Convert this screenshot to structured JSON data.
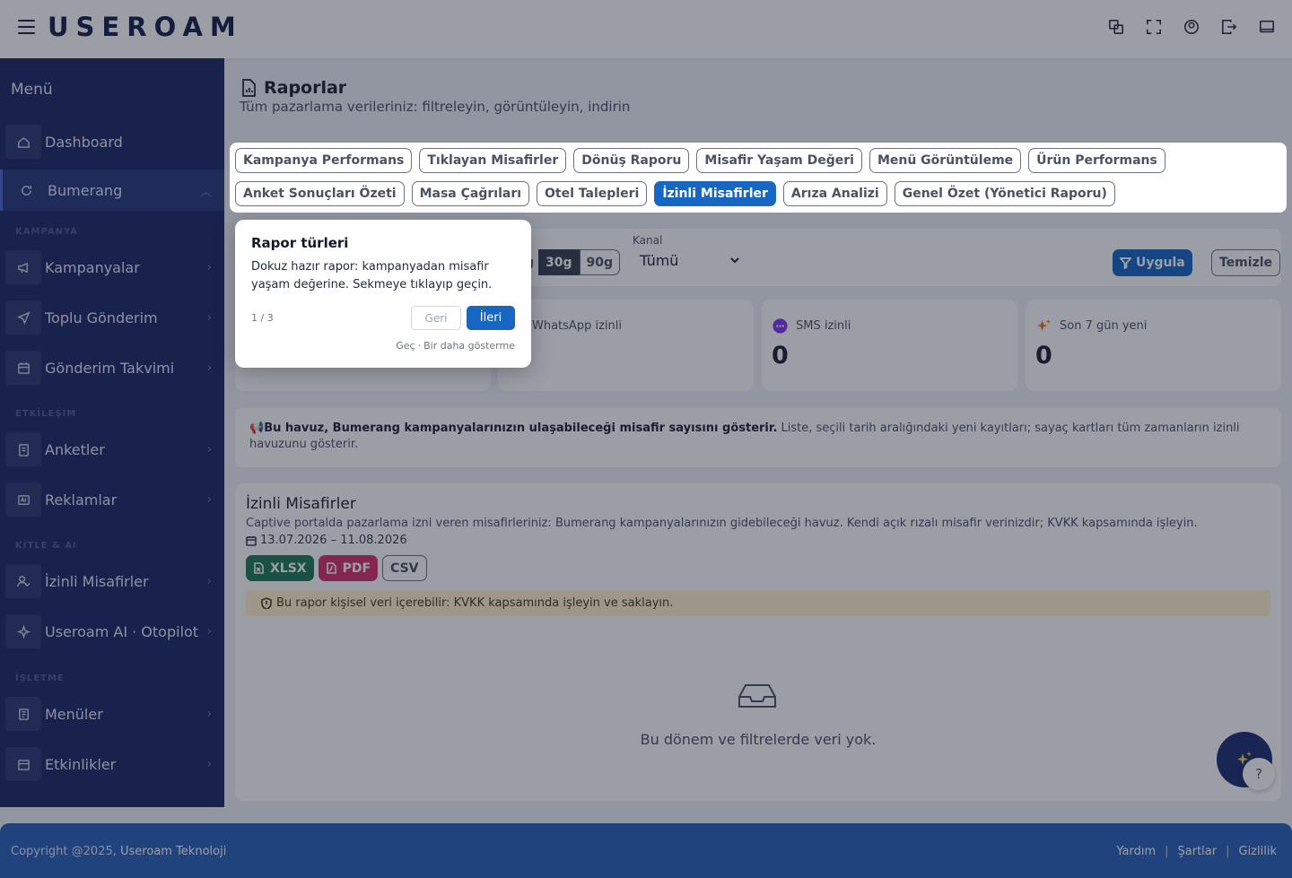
{
  "header": {
    "logo": "USEROAM",
    "icons": [
      "translate-icon",
      "fullscreen-icon",
      "user-icon",
      "logout-icon",
      "monitor-icon"
    ]
  },
  "sidebar": {
    "title": "Menü",
    "items": [
      {
        "label": "Dashboard",
        "icon": "home-icon"
      },
      {
        "label": "Bumerang",
        "icon": "refresh-icon"
      },
      {
        "label": "Kampanyalar",
        "icon": "megaphone-icon"
      },
      {
        "label": "Toplu Gönderim",
        "icon": "send-icon"
      },
      {
        "label": "Gönderim Takvimi",
        "icon": "calendar-icon"
      },
      {
        "label": "Anketler",
        "icon": "clipboard-icon"
      },
      {
        "label": "Reklamlar",
        "icon": "ad-icon"
      },
      {
        "label": "İzinli Misafirler",
        "icon": "user-check-icon"
      },
      {
        "label": "Useroam AI · Otopilot",
        "icon": "sparkle-icon"
      },
      {
        "label": "Menüler",
        "icon": "menu-book-icon"
      },
      {
        "label": "Etkinlikler",
        "icon": "event-icon"
      }
    ],
    "sections": [
      "KAMPANYA",
      "ETKİLEŞİM",
      "KİTLE & AI",
      "İŞLETME"
    ]
  },
  "page": {
    "title": "Raporlar",
    "subtitle": "Tüm pazarlama verileriniz: filtreleyin, görüntüleyin, indirin"
  },
  "tabs": [
    [
      "Kampanya Performans",
      "Tıklayan Misafirler",
      "Dönüş Raporu",
      "Misafir Yaşam Değeri",
      "Menü Görüntüleme",
      "Ürün Performans"
    ],
    [
      "Anket Sonuçları Özeti",
      "Masa Çağrıları",
      "Otel Talepleri",
      "İzinli Misafirler",
      "Arıza Analizi",
      "Genel Özet (Yönetici Raporu)"
    ]
  ],
  "active_tab": "İzinli Misafirler",
  "filters": {
    "ranges": [
      "g",
      "30g",
      "90g"
    ],
    "active_range": "30g",
    "kanal_label": "Kanal",
    "kanal_value": "Tümü",
    "apply": "Uygula",
    "clear": "Temizle"
  },
  "stats": [
    {
      "label": "WhatsApp izinli",
      "value": "",
      "icon": "whatsapp-icon"
    },
    {
      "label": "SMS izinli",
      "value": "0",
      "icon": "sms-icon"
    },
    {
      "label": "Son 7 gün yeni",
      "value": "0",
      "icon": "sparkle-icon"
    }
  ],
  "info": {
    "bold": "Bu havuz, Bumerang kampanyalarınızın ulaşabileceği misafir sayısını gösterir.",
    "text": " Liste, seçili tarih aralığındaki yeni kayıtları; sayaç kartları tüm zamanların izinli havuzunu gösterir."
  },
  "report": {
    "title": "İzinli Misafirler",
    "description": "Captive portalda pazarlama izni veren misafirleriniz: Bumerang kampanyalarınızın gidebileceği havuz. Kendi açık rızalı misafir verinizdir; KVKK kapsamında işleyin.",
    "date_range": "13.07.2026 – 11.08.2026",
    "exports": [
      "XLSX",
      "PDF",
      "CSV"
    ],
    "kvkk_note": "Bu rapor kişisel veri içerebilir: KVKK kapsamında işleyin ve saklayın.",
    "empty": "Bu dönem ve filtrelerde veri yok."
  },
  "tour": {
    "title": "Rapor türleri",
    "body": "Dokuz hazır rapor: kampanyadan misafir yaşam değerine. Sekmeye tıklayıp geçin.",
    "step": "1 / 3",
    "back": "Geri",
    "next": "İleri",
    "skip": "Geç",
    "sep": "·",
    "dont_show": "Bir daha gösterme"
  },
  "footer": {
    "copyright": "Copyright @2025,",
    "company": "Useroam Teknoloji",
    "links": [
      "Yardım",
      "Şartlar",
      "Gizlilik"
    ],
    "separator": "|"
  },
  "help": "?",
  "colors": {
    "primary": "#1766c2",
    "sidebar": "#1c2a66",
    "footer": "#2a63b8",
    "xlsx": "#1f7a58",
    "pdf": "#d6336c",
    "warning": "#fff3cd"
  }
}
